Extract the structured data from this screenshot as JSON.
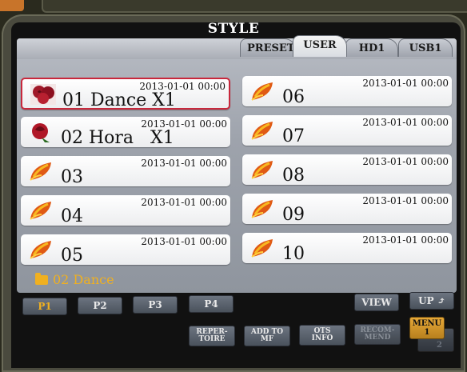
{
  "title": "STYLE",
  "tabs": [
    {
      "label": "PRESET",
      "active": false
    },
    {
      "label": "USER",
      "active": true
    },
    {
      "label": "HD1",
      "active": false
    },
    {
      "label": "USB1",
      "active": false
    }
  ],
  "files": [
    {
      "name": "01 Dance X1",
      "date": "2013-01-01 00:00",
      "icon": "rose-icon",
      "selected": true
    },
    {
      "name": "02 Hora   X1",
      "date": "2013-01-01 00:00",
      "icon": "rose-icon",
      "selected": false
    },
    {
      "name": "03",
      "date": "2013-01-01 00:00",
      "icon": "leaf-icon",
      "selected": false
    },
    {
      "name": "04",
      "date": "2013-01-01 00:00",
      "icon": "leaf-icon",
      "selected": false
    },
    {
      "name": "05",
      "date": "2013-01-01 00:00",
      "icon": "leaf-icon",
      "selected": false
    },
    {
      "name": "06",
      "date": "2013-01-01 00:00",
      "icon": "leaf-icon",
      "selected": false
    },
    {
      "name": "07",
      "date": "2013-01-01 00:00",
      "icon": "leaf-icon",
      "selected": false
    },
    {
      "name": "08",
      "date": "2013-01-01 00:00",
      "icon": "leaf-icon",
      "selected": false
    },
    {
      "name": "09",
      "date": "2013-01-01 00:00",
      "icon": "leaf-icon",
      "selected": false
    },
    {
      "name": "10",
      "date": "2013-01-01 00:00",
      "icon": "leaf-icon",
      "selected": false
    }
  ],
  "folder": {
    "label": "02 Dance",
    "icon": "folder-icon"
  },
  "pages": [
    {
      "label": "P1",
      "selected": true
    },
    {
      "label": "P2",
      "selected": false
    },
    {
      "label": "P3",
      "selected": false
    },
    {
      "label": "P4",
      "selected": false
    }
  ],
  "buttons": {
    "view": "VIEW",
    "up": "UP",
    "repertoire_1": "REPER-",
    "repertoire_2": "TOIRE",
    "add_to_mf_1": "ADD TO",
    "add_to_mf_2": "MF",
    "ots_info_1": "OTS",
    "ots_info_2": "INFO",
    "recommend_1": "RECOM-",
    "recommend_2": "MEND",
    "menu1_1": "MENU",
    "menu1_2": "1",
    "menu2": "2"
  },
  "colors": {
    "selected_border": "#c8283c",
    "folder": "#f0b020",
    "menu_button": "#e6a838"
  }
}
